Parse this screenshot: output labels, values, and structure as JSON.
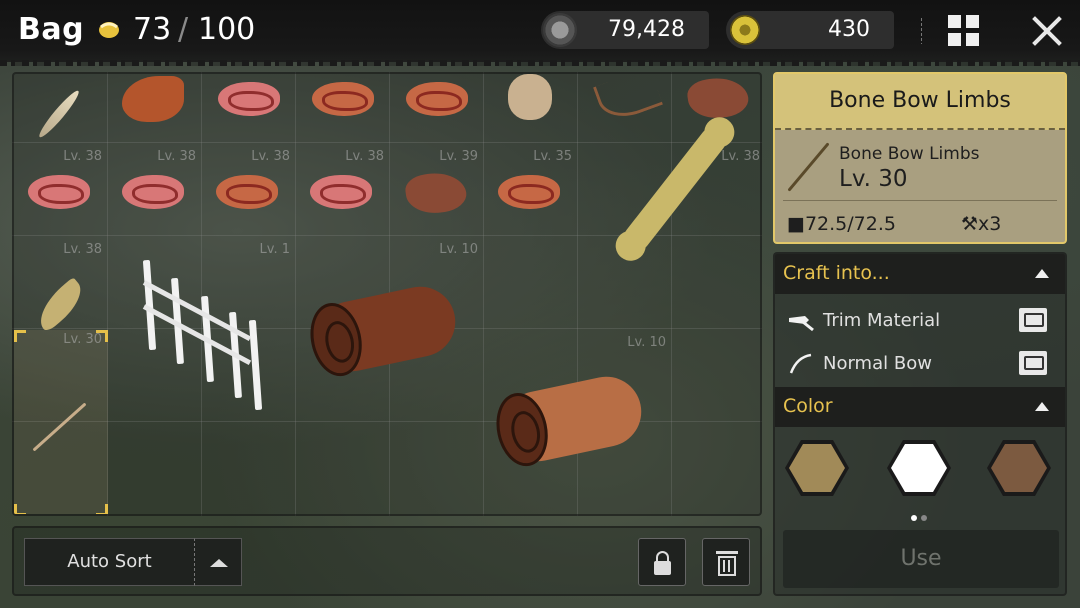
{
  "header": {
    "title": "Bag",
    "capacity_current": "73",
    "capacity_separator": "/",
    "capacity_max": "100",
    "currency_primary": "79,428",
    "currency_secondary": "430"
  },
  "grid": {
    "levels": [
      "Lv. 38",
      "Lv. 38",
      "Lv. 38",
      "Lv. 38",
      "Lv. 39",
      "Lv. 35",
      "Lv. 38",
      "Lv. 38",
      "Lv. 1",
      "Lv. 10",
      "Lv. 30",
      "Lv. 10"
    ]
  },
  "bottom": {
    "sort_label": "Auto Sort"
  },
  "detail": {
    "header_title": "Bone Bow Limbs",
    "item_name": "Bone Bow Limbs",
    "item_level": "Lv. 30",
    "weight": "72.5/72.5",
    "craft_count": "x3"
  },
  "craft": {
    "title": "Craft into...",
    "options": [
      {
        "label": "Trim Material"
      },
      {
        "label": "Normal Bow"
      }
    ]
  },
  "color": {
    "title": "Color",
    "swatches": [
      "#a18a58",
      "#ffffff",
      "#7c5a40"
    ]
  },
  "use": {
    "label": "Use"
  },
  "colors": {
    "accent": "#e7c24f",
    "panel_gold": "#d4c27a"
  }
}
